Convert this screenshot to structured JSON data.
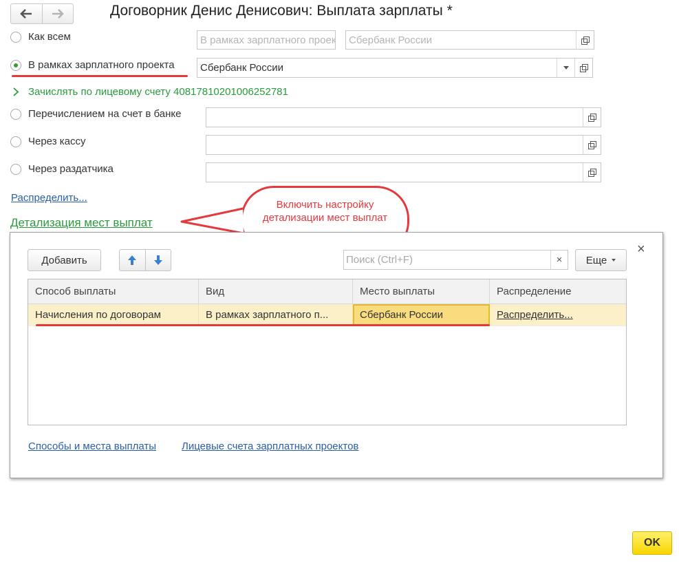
{
  "window": {
    "title": "Договорник Денис Денисович: Выплата зарплаты *"
  },
  "payment_options": [
    {
      "label": "Как всем",
      "selected": false
    },
    {
      "label": "В рамках зарплатного проекта",
      "selected": true
    },
    {
      "label": "Перечислением на счет в банке",
      "selected": false
    },
    {
      "label": "Через кассу",
      "selected": false
    },
    {
      "label": "Через раздатчика",
      "selected": false
    }
  ],
  "as_all_fields": {
    "project": "В рамках зарплатного проекта",
    "bank": "Сбербанк России"
  },
  "salary_project_field": {
    "value": "Сбербанк России"
  },
  "account_link": "Зачислять по лицевому счету 40817810201006252781",
  "distribute_link": "Распределить...",
  "detail_link": "Детализация мест выплат",
  "callout": {
    "text": "Включить настройку детализации мест выплат"
  },
  "panel": {
    "add_button": "Добавить",
    "search_placeholder": "Поиск (Ctrl+F)",
    "search_clear": "×",
    "more_button": "Еще",
    "close": "×",
    "columns": [
      "Способ выплаты",
      "Вид",
      "Место выплаты",
      "Распределение"
    ],
    "rows": [
      {
        "method": "Начисления по договорам",
        "type": "В рамках зарплатного п...",
        "place": "Сбербанк России",
        "distribution": "Распределить..."
      }
    ],
    "footer_links": [
      "Способы и места выплаты",
      "Лицевые счета зарплатных проектов"
    ]
  },
  "ok_button": "OK",
  "colors": {
    "accent_green": "#2a9b3e",
    "link_blue": "#2a5eaa",
    "annotation_red": "#e5393c",
    "ok_yellow": "#f7d600",
    "row_highlight": "#fbf0c8"
  }
}
